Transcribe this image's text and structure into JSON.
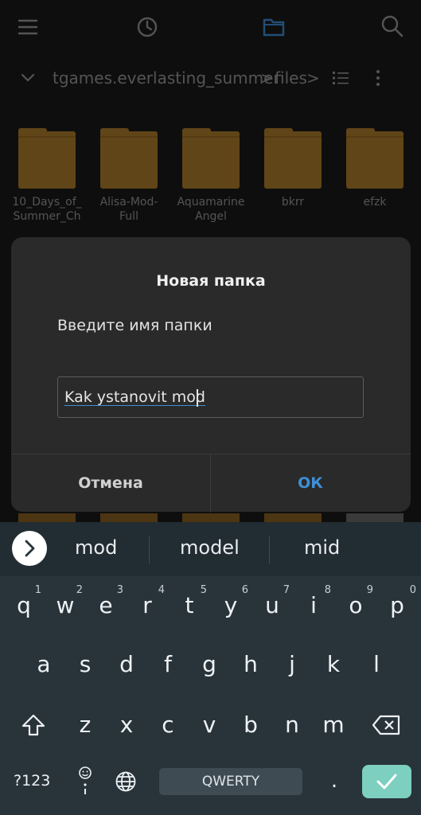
{
  "toolbar": {
    "icons": [
      "menu-icon",
      "history-icon",
      "folder-icon",
      "search-icon"
    ],
    "accent": "#3f8fd6"
  },
  "pathbar": {
    "path_root": "tgames.everlasting_summer",
    "sep1": ">",
    "path_child": "files",
    "sep2": ">"
  },
  "folders": [
    {
      "line1": "10_Days_of_",
      "line2": "Summer_Ch"
    },
    {
      "line1": "Alisa-Mod-",
      "line2": "Full"
    },
    {
      "line1": "Aquamarine",
      "line2": "Angel"
    },
    {
      "line1": "bkrr",
      "line2": ""
    },
    {
      "line1": "efzk",
      "line2": ""
    }
  ],
  "dialog": {
    "title": "Новая папка",
    "message": "Введите имя папки",
    "input_value": "Kak ystanovit mod",
    "cancel_label": "Отмена",
    "ok_label": "ОК",
    "ok_color": "#3f8fd6"
  },
  "suggestions": [
    "mod",
    "model",
    "mid"
  ],
  "keyboard": {
    "row1": [
      {
        "k": "q",
        "n": "1"
      },
      {
        "k": "w",
        "n": "2"
      },
      {
        "k": "e",
        "n": "3"
      },
      {
        "k": "r",
        "n": "4"
      },
      {
        "k": "t",
        "n": "5"
      },
      {
        "k": "y",
        "n": "6"
      },
      {
        "k": "u",
        "n": "7"
      },
      {
        "k": "i",
        "n": "8"
      },
      {
        "k": "o",
        "n": "9"
      },
      {
        "k": "p",
        "n": "0"
      }
    ],
    "row2": [
      "a",
      "s",
      "d",
      "f",
      "g",
      "h",
      "j",
      "k",
      "l"
    ],
    "row3": [
      "z",
      "x",
      "c",
      "v",
      "b",
      "n",
      "m"
    ],
    "sym_label": "?123",
    "space_label": "QWERTY",
    "period": ".",
    "enter_color": "#7dcfc0"
  }
}
